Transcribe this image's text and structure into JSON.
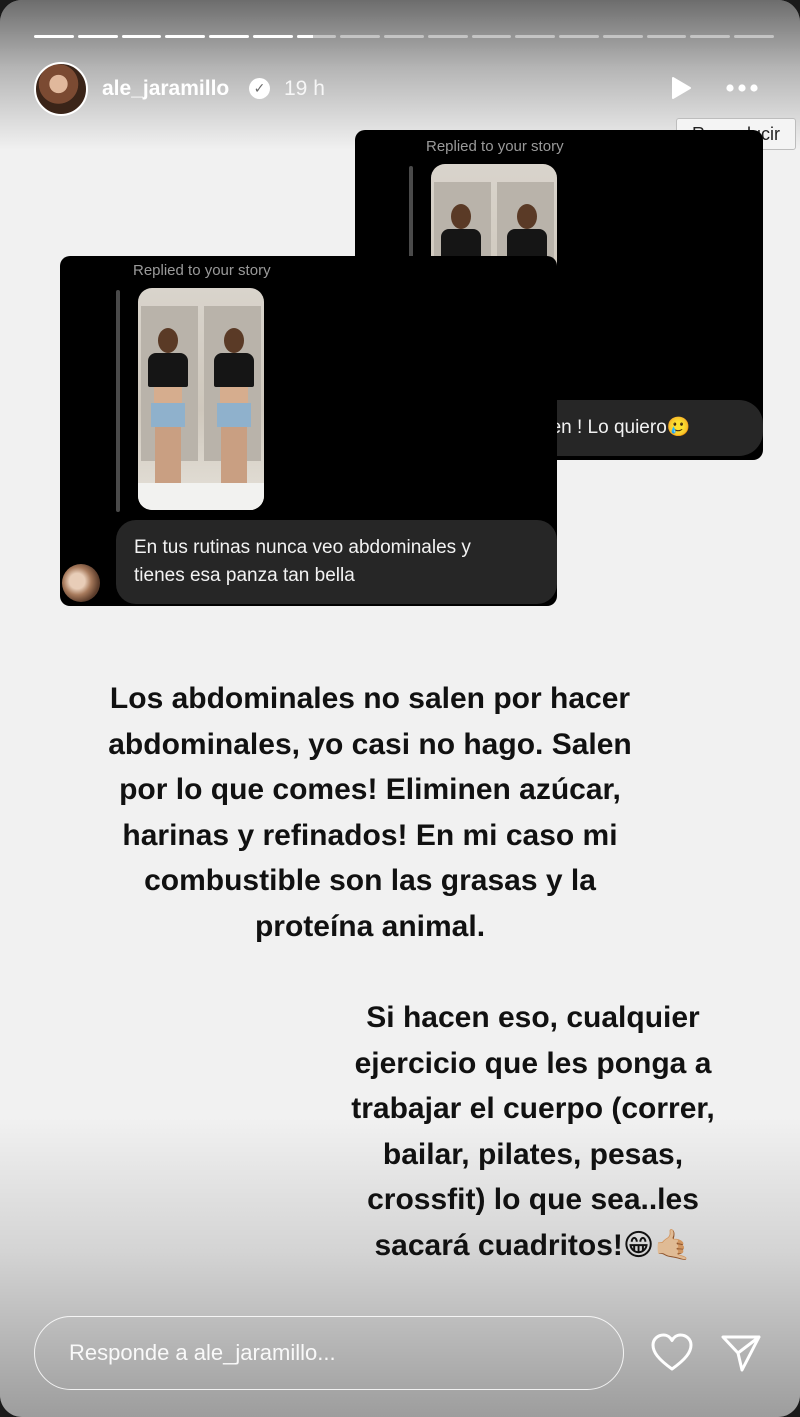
{
  "story": {
    "progress": {
      "total_segments": 17,
      "completed_segments": 6,
      "current_fraction": 0.4
    },
    "header": {
      "username": "ale_jaramillo",
      "verified_icon": "verified-badge-icon",
      "time": "19 h",
      "play_icon": "play-icon",
      "more_icon": "more-horizontal-icon",
      "tooltip": "Reproducir"
    },
    "screenshots": [
      {
        "replied_label": "Replied to your story",
        "message": "Amo tu abdomen ! Lo quiero🥲"
      },
      {
        "replied_label": "Replied to your story",
        "message_line1": "En tus rutinas nunca veo abdominales y",
        "message_line2": "tienes esa panza tan bella"
      }
    ],
    "text_block_1": [
      "Los abdominales no salen por hacer",
      "abdominales, yo casi no hago. Salen",
      "por lo que comes! Eliminen azúcar,",
      "harinas y refinados! En mi caso mi",
      "combustible son las grasas y la",
      "proteína animal."
    ],
    "text_block_2": [
      "Si hacen eso, cualquier",
      "ejercicio que les ponga a",
      "trabajar el cuerpo (correr,",
      "bailar, pilates, pesas,",
      "crossfit) lo que sea..les",
      "sacará cuadritos!😁🤙🏼"
    ],
    "reply": {
      "placeholder": "Responde a ale_jaramillo...",
      "heart_icon": "heart-icon",
      "send_icon": "send-icon"
    }
  }
}
